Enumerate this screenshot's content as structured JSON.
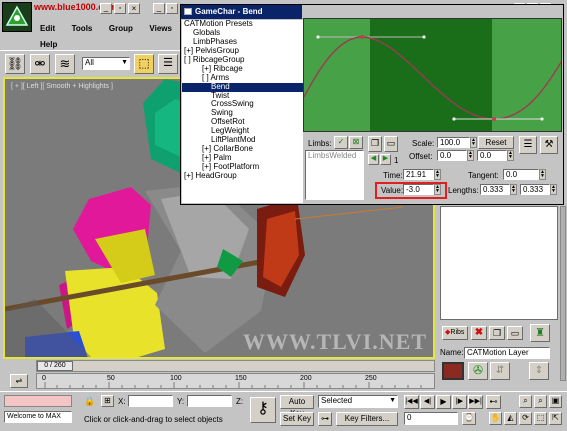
{
  "app": {
    "menu": [
      "Edit",
      "Tools",
      "Group",
      "Views"
    ],
    "menu2": "Help",
    "watermark_top": "www.blue1000.com",
    "watermark_bottom": "WWW.TLVI.NET",
    "selection_filter": "All",
    "viewport_label": "[ + ][ Left ][ Smooth + Highlights ]"
  },
  "dialog": {
    "title": "GameChar - Bend",
    "tree": [
      {
        "label": "CATMotion Presets",
        "indent": 0
      },
      {
        "label": "Globals",
        "indent": 1
      },
      {
        "label": "LimbPhases",
        "indent": 1
      },
      {
        "label": "[+] PelvisGroup",
        "indent": 0
      },
      {
        "label": "[ ] RibcageGroup",
        "indent": 0
      },
      {
        "label": "[+] Ribcage",
        "indent": 2
      },
      {
        "label": "[ ] Arms",
        "indent": 2
      },
      {
        "label": "Bend",
        "indent": 3,
        "selected": true
      },
      {
        "label": "Twist",
        "indent": 3
      },
      {
        "label": "CrossSwing",
        "indent": 3
      },
      {
        "label": "Swing",
        "indent": 3
      },
      {
        "label": "OffsetRot",
        "indent": 3
      },
      {
        "label": "LegWeight",
        "indent": 3
      },
      {
        "label": "LiftPlantMod",
        "indent": 3
      },
      {
        "label": "[+] CollarBone",
        "indent": 2
      },
      {
        "label": "[+] Palm",
        "indent": 2
      },
      {
        "label": "[+] FootPlatform",
        "indent": 2
      },
      {
        "label": "[+] HeadGroup",
        "indent": 0
      }
    ],
    "limbs_label": "Limbs:",
    "limbs_list": "LimbsWelded",
    "frame_num": "1",
    "scale_label": "Scale:",
    "scale_value": "100.0",
    "reset_label": "Reset",
    "offset_label": "Offset:",
    "offset_value_1": "0.0",
    "offset_value_2": "0.0",
    "time_label": "Time:",
    "time_value": "21.91",
    "tangent_label": "Tangent:",
    "tangent_value": "0.0",
    "value_label": "Value:",
    "value_value": "-3.0",
    "lengths_label": "Lengths:",
    "lengths_value_1": "0.333",
    "lengths_value_2": "0.333"
  },
  "right_panel": {
    "name_label": "Name:",
    "name_value": "CATMotion Layer",
    "ribs_label": "Ribs"
  },
  "timeline": {
    "frame_display": "0 / 260",
    "ticks": [
      "0",
      "50",
      "100",
      "150",
      "200",
      "250"
    ]
  },
  "status": {
    "welcome": "Welcome to MAX",
    "x_label": "X:",
    "y_label": "Y:",
    "z_label": "Z:",
    "prompt": "Click or click-and-drag to select objects",
    "auto_key": "Auto Key",
    "set_key": "Set Key",
    "selected": "Selected",
    "key_filters": "Key Filters...",
    "frame_field": "0"
  },
  "colors": {
    "graph_bg": "#47a247",
    "graph_band": "#1a6e1a",
    "curve": "#9d3a52",
    "selected_tree": "#0a246a",
    "highlight_box": "#e02020",
    "viewport_frame": "#e6e63a"
  }
}
